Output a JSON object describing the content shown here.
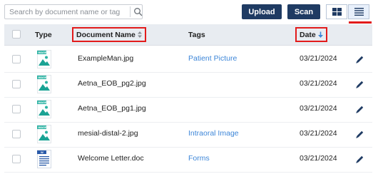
{
  "search": {
    "placeholder": "Search by document name or tag",
    "icon": "search-icon"
  },
  "toolbar": {
    "upload_label": "Upload",
    "scan_label": "Scan",
    "grid_view_icon": "grid-view-icon",
    "list_view_icon": "list-view-icon",
    "active_view": "list",
    "accent": "#1f3b63",
    "highlight": "#e21b1b"
  },
  "table": {
    "headers": {
      "type": "Type",
      "document_name": "Document Name",
      "tags": "Tags",
      "date": "Date"
    },
    "rows": [
      {
        "file_type": "image",
        "icon_label": "IMAGE",
        "name": "ExampleMan.jpg",
        "tag": "Patient Picture",
        "date": "03/21/2024"
      },
      {
        "file_type": "image",
        "icon_label": "IMAGE",
        "name": "Aetna_EOB_pg2.jpg",
        "tag": "",
        "date": "03/21/2024"
      },
      {
        "file_type": "image",
        "icon_label": "IMAGE",
        "name": "Aetna_EOB_pg1.jpg",
        "tag": "",
        "date": "03/21/2024"
      },
      {
        "file_type": "image",
        "icon_label": "IMAGE",
        "name": "mesial-distal-2.jpg",
        "tag": "Intraoral Image",
        "date": "03/21/2024"
      },
      {
        "file_type": "doc",
        "icon_label": "W",
        "name": "Welcome Letter.doc",
        "tag": "Forms",
        "date": "03/21/2024"
      }
    ]
  }
}
